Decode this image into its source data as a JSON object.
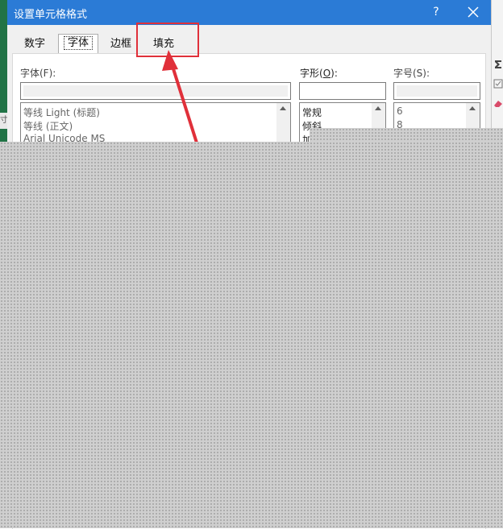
{
  "dialog": {
    "title": "设置单元格格式",
    "help_label": "?"
  },
  "tabs": [
    {
      "label": "数字",
      "active": false
    },
    {
      "label": "字体",
      "active": true
    },
    {
      "label": "边框",
      "active": false
    },
    {
      "label": "填充",
      "active": false
    }
  ],
  "font_section": {
    "label": "字体(F):",
    "value": "",
    "options": [
      "等线 Light (标题)",
      "等线 (正文)",
      "Arial Unicode MS"
    ]
  },
  "style_section": {
    "label_prefix": "字形(",
    "label_key": "O",
    "label_suffix": "):",
    "value": "",
    "options": [
      "常规",
      "倾斜",
      "加"
    ]
  },
  "size_section": {
    "label": "字号(S):",
    "value": "",
    "options": [
      "6",
      "8"
    ]
  },
  "annotation": {
    "color": "#e0303a",
    "target": "填充"
  },
  "background_edge_text": "寸"
}
